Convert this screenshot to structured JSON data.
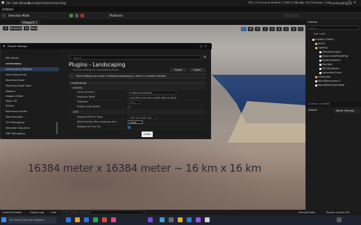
{
  "window": {
    "title": "Untitled",
    "project": "Landscaping_51"
  },
  "menu": [
    "File",
    "Edit",
    "Window",
    "Tools",
    "Build",
    "Select",
    "Actor",
    "Help"
  ],
  "top_stats": "FPS: 117.6   ms: 8.50   Mem: 2,768.71 MB   Objs: 59,794   Draw: 1,153",
  "toolbar": {
    "mode": "Selection Mode",
    "platforms": "Platforms"
  },
  "viewport_tab": "Viewport 1",
  "viewport": {
    "perspective": "Perspective",
    "lit": "Lit",
    "show": "Show",
    "camera_speed": "4"
  },
  "caption": "16384 meter x 16384 meter ~ 16 km x 16 km",
  "project_settings": {
    "title": "Project Settings",
    "search_placeholder": "Search",
    "heading": "Plugins - Landscaping",
    "subheading": "General settings for Landscaping Plugin",
    "export_label": "Export",
    "import_label": "Import",
    "warning": "These settings are saved in DefaultLandscaping.ini, which is currently writable.",
    "sidebar": [
      "IMG Media",
      "Landscaping",
      "Landscaping Mapbox",
      "Level Sequences",
      "Modeling Mode",
      "Modeling Mode Tools",
      "Niagara",
      "Niagara Editor",
      "Paper 2D",
      "Python",
      "Resonance Audio",
      "Take Recorder",
      "TCP Messaging",
      "Template Sequence",
      "UDP Messaging"
    ],
    "selected_sidebar": "Landscaping",
    "sections": {
      "landscaping": "Landscaping",
      "internal": "Internal",
      "dtm": "DTM"
    },
    "rows": [
      {
        "label": "Cache Directory",
        "value": "D:/Temp/Landscaping"
      },
      {
        "label": "Projection Mode",
        "value": "Use CRS of Input File or EPSG 3857 for Mapbox import"
      },
      {
        "label": "Projection",
        "value": "EPSG"
      },
      {
        "label": "Enable Large Worlds",
        "value": ""
      },
      {
        "label": "Allowed DTM File Types",
        "value": "*.tif;*.asc;*.hgt;*.xyz"
      },
      {
        "label": "World Partition Max Landscape Size",
        "value": "16384"
      },
      {
        "label": "Reproject to First Tile",
        "value": ""
      }
    ],
    "tooltip": "16384"
  },
  "outliner": {
    "title": "Outliner",
    "search_placeholder": "Search...",
    "col_label": "Item Label",
    "items": [
      {
        "label": "Untitled (Editor)",
        "color": "#e0e0e0"
      },
      {
        "label": "HLOD",
        "color": "#d7b95a"
      },
      {
        "label": "Lighting",
        "color": "#d7b95a"
      },
      {
        "label": "DirectionalLight",
        "color": "#e8e8e8"
      },
      {
        "label": "ExponentialHeightFog",
        "color": "#e8e8e8"
      },
      {
        "label": "SkyAtmosphere",
        "color": "#e8e8e8"
      },
      {
        "label": "SkyLight",
        "color": "#e8e8e8"
      },
      {
        "label": "SM_SkySphere",
        "color": "#e8e8e8"
      },
      {
        "label": "VolumetricCloud",
        "color": "#e8e8e8"
      },
      {
        "label": "Landscape",
        "color": "#d7b95a"
      },
      {
        "label": "WorldDataLayers-1",
        "color": "#e8e8e8"
      },
      {
        "label": "WorldPartitionMiniMap",
        "color": "#e8e8e8"
      }
    ],
    "footer": "12 actors (1 loaded)"
  },
  "details": {
    "tab_details": "Details",
    "tab_world": "World Settings"
  },
  "statusbar": {
    "content_drawer": "Content Drawer",
    "output_log": "Output Log",
    "cmd": "Cmd",
    "console_placeholder": "Enter Console Command",
    "derived": "Derived Data",
    "source": "Source Control Off"
  },
  "taskbar": {
    "search_text": "Zur Suche Text hier eingeben",
    "icons": [
      "#2a7ad9",
      "#e8a23a",
      "#2e6fd6",
      "#2aa85a",
      "#d94a3a",
      "#e04a8a",
      "#7a4ad9",
      "#3aa0d9",
      "#6a6a6a",
      "#d9b23a",
      "#2a7ad9",
      "#8a5ad9",
      "#d0d0d0",
      "#5a5a5a"
    ]
  }
}
